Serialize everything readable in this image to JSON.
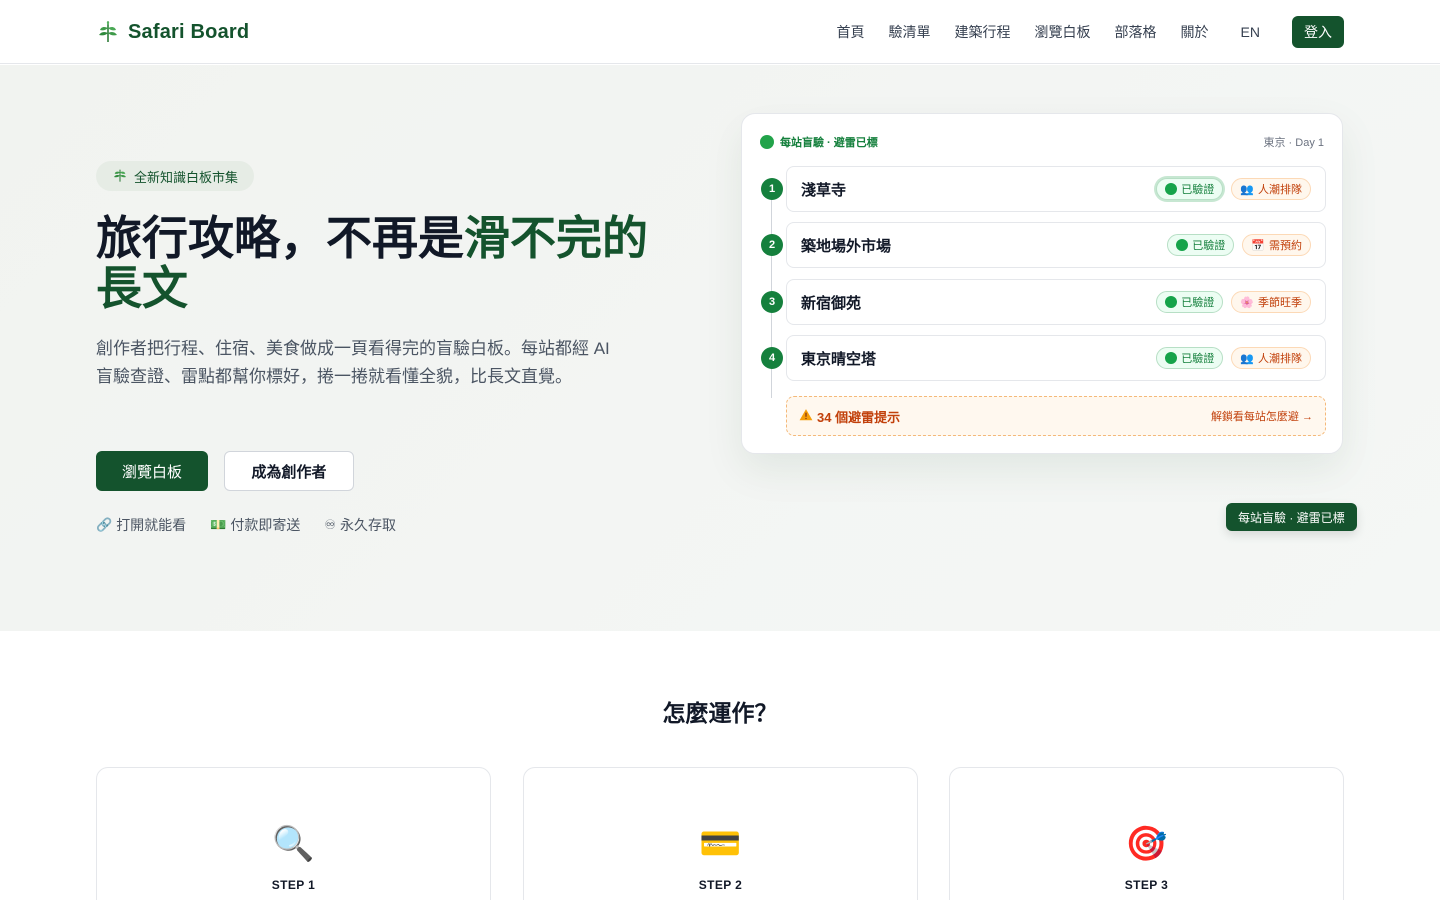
{
  "nav": {
    "brand": "Safari Board",
    "brand_icon": "leaf-icon",
    "links": [
      "首頁",
      "驗清單",
      "建築行程",
      "瀏覽白板",
      "部落格",
      "關於"
    ],
    "lang": "EN",
    "login": "登入"
  },
  "hero": {
    "badge": "全新知識白板市集",
    "title_plain": "旅行攻略，不再是",
    "title_accent": "滑不完的長文",
    "description": "創作者把行程、住宿、美食做成一頁看得完的盲驗白板。每站都經 AI 盲驗查證、雷點都幫你標好，捲一捲就看懂全貌，比長文直覺。",
    "primary_button": "瀏覽白板",
    "secondary_button": "成為創作者",
    "perks": [
      {
        "icon": "🔗",
        "label": "打開就能看"
      },
      {
        "icon": "💵",
        "label": "付款即寄送"
      },
      {
        "icon": "♾",
        "label": "永久存取"
      }
    ]
  },
  "preview": {
    "header_left": "每站盲驗 · 避雷已標",
    "header_right": "東京 · Day 1",
    "stops": [
      {
        "num": "1",
        "name": "淺草寺",
        "verified": "已驗證",
        "note_icon": "👥",
        "note": "人潮排隊"
      },
      {
        "num": "2",
        "name": "築地場外市場",
        "verified": "已驗證",
        "note_icon": "📅",
        "note": "需預約"
      },
      {
        "num": "3",
        "name": "新宿御苑",
        "verified": "已驗證",
        "note_icon": "🌸",
        "note": "季節旺季"
      },
      {
        "num": "4",
        "name": "東京晴空塔",
        "verified": "已驗證",
        "note_icon": "👥",
        "note": "人潮排隊"
      }
    ],
    "alert_text": "34 個避雷提示",
    "alert_link": "解鎖看每站怎麼避 →",
    "chip": "每站盲驗 · 避雷已標"
  },
  "how": {
    "title": "怎麼運作？",
    "steps": [
      {
        "icon": "🔍",
        "label": "STEP 1"
      },
      {
        "icon": "💳",
        "label": "STEP 2"
      },
      {
        "icon": "🎯",
        "label": "STEP 3"
      }
    ]
  },
  "colors": {
    "brand_dark": "#14532d",
    "brand_green": "#15803d",
    "warn_orange": "#c2410c"
  }
}
